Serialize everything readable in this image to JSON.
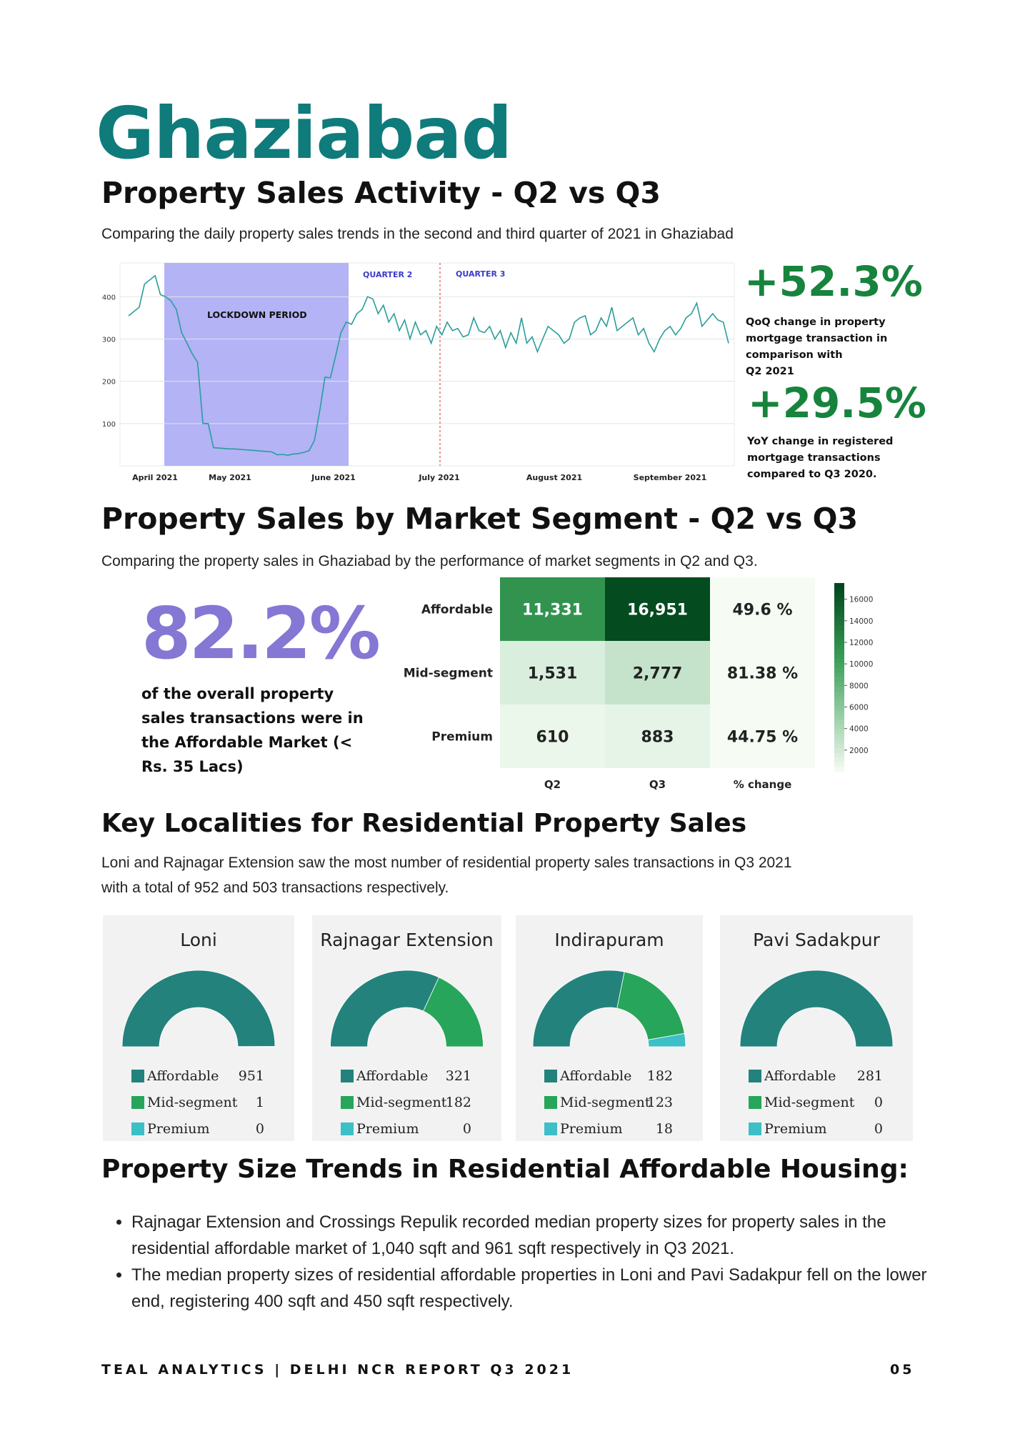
{
  "city": "Ghaziabad",
  "section1": {
    "title": "Property Sales Activity - Q2 vs Q3",
    "subtitle": "Comparing the daily property sales trends in the second and third quarter of 2021 in Ghaziabad"
  },
  "chart_data": [
    {
      "type": "line",
      "title": "",
      "xlabel": "",
      "ylabel": "",
      "x_tick_labels": [
        "April 2021",
        "May 2021",
        "June 2021",
        "July 2021",
        "August 2021",
        "September 2021"
      ],
      "y_ticks": [
        100,
        200,
        300,
        400
      ],
      "ylim": [
        0,
        480
      ],
      "annotations": [
        "LOCKDOWN PERIOD",
        "QUARTER 2",
        "QUARTER 3"
      ],
      "shaded_region": {
        "label": "LOCKDOWN PERIOD",
        "color": "#b3b3f6"
      },
      "series": [
        {
          "color": "#2a9d9b",
          "values": [
            355,
            365,
            375,
            430,
            440,
            450,
            405,
            400,
            390,
            370,
            315,
            290,
            265,
            245,
            100,
            100,
            43,
            42,
            41,
            40,
            40,
            39,
            38,
            37,
            36,
            35,
            34,
            33,
            26,
            27,
            25,
            28,
            29,
            32,
            36,
            60,
            130,
            210,
            208,
            260,
            315,
            340,
            335,
            360,
            370,
            400,
            395,
            360,
            380,
            340,
            360,
            320,
            345,
            300,
            340,
            310,
            320,
            290,
            330,
            310,
            340,
            320,
            325,
            305,
            310,
            350,
            320,
            315,
            330,
            300,
            320,
            280,
            315,
            290,
            350,
            290,
            305,
            270,
            300,
            330,
            320,
            310,
            290,
            300,
            340,
            350,
            355,
            310,
            320,
            350,
            330,
            375,
            320,
            330,
            340,
            350,
            310,
            325,
            290,
            270,
            300,
            320,
            330,
            310,
            325,
            350,
            360,
            385,
            330,
            345,
            360,
            345,
            340,
            290
          ]
        }
      ]
    },
    {
      "type": "heatmap",
      "rows": [
        "Affordable",
        "Mid-segment",
        "Premium"
      ],
      "columns": [
        "Q2",
        "Q3",
        "% change"
      ],
      "values": [
        [
          11331,
          16951
        ],
        [
          1531,
          2777
        ],
        [
          610,
          883
        ]
      ],
      "cell_labels": [
        [
          "11,331",
          "16,951",
          "49.6 %"
        ],
        [
          "1,531",
          "2,777",
          "81.38 %"
        ],
        [
          "610",
          "883",
          "44.75 %"
        ]
      ],
      "colorbar_ticks": [
        2000,
        4000,
        6000,
        8000,
        10000,
        12000,
        14000,
        16000
      ]
    },
    {
      "type": "pie",
      "title": "Loni",
      "categories": [
        "Affordable",
        "Mid-segment",
        "Premium"
      ],
      "values": [
        951,
        1,
        0
      ]
    },
    {
      "type": "pie",
      "title": "Rajnagar Extension",
      "categories": [
        "Affordable",
        "Mid-segment",
        "Premium"
      ],
      "values": [
        321,
        182,
        0
      ]
    },
    {
      "type": "pie",
      "title": "Indirapuram",
      "categories": [
        "Affordable",
        "Mid-segment",
        "Premium"
      ],
      "values": [
        182,
        123,
        18
      ]
    },
    {
      "type": "pie",
      "title": "Pavi Sadakpur",
      "categories": [
        "Affordable",
        "Mid-segment",
        "Premium"
      ],
      "values": [
        281,
        0,
        0
      ]
    }
  ],
  "stats": {
    "qoq_value": "+52.3%",
    "qoq_note": [
      "QoQ change in property",
      "mortgage transaction in",
      "comparison with",
      "Q2 2021"
    ],
    "yoy_value": "+29.5%",
    "yoy_note": [
      "YoY change in registered",
      "mortgage transactions",
      "compared to Q3 2020."
    ]
  },
  "section2": {
    "title": "Property Sales by Market Segment - Q2 vs Q3",
    "subtitle": "Comparing the property sales in Ghaziabad by the performance of market segments in Q2 and Q3.",
    "big_pct": "82.2%",
    "big_pct_note": "of the overall property sales transactions were in the Affordable Market (< Rs. 35 Lacs)"
  },
  "section3": {
    "title": "Key Localities for Residential Property Sales",
    "subtitle_line1": "Loni and Rajnagar Extension saw the most number of residential property sales transactions in Q3 2021",
    "subtitle_line2": "with a total of 952 and 503 transactions respectively.",
    "colors": {
      "affordable": "#23827c",
      "mid": "#27a55a",
      "premium": "#3dbfc7"
    }
  },
  "section4": {
    "title": "Property Size Trends in Residential Affordable Housing:",
    "bullets": [
      "Rajnagar Extension and Crossings Repulik recorded median property sizes for property sales in the residential affordable market of 1,040 sqft and 961 sqft respectively in Q3 2021.",
      "The median property sizes of residential affordable properties in Loni and Pavi Sadakpur fell on the lower end, registering 400 sqft and 450 sqft respectively."
    ]
  },
  "footer": {
    "left": "TEAL ANALYTICS | DELHI NCR REPORT Q3 2021",
    "right": "05"
  }
}
